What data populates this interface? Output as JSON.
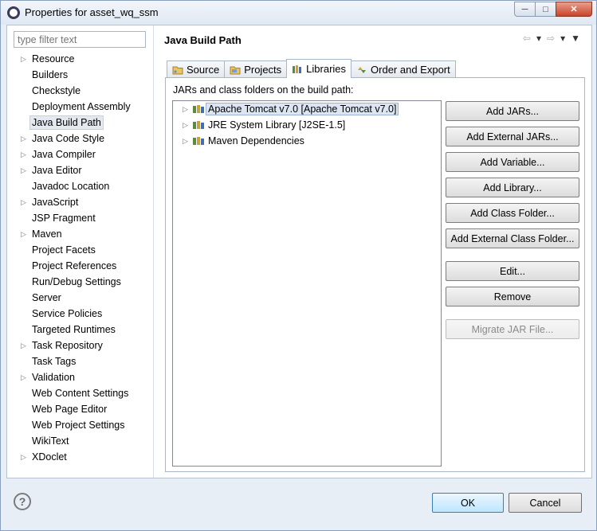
{
  "window": {
    "title": "Properties for asset_wq_ssm",
    "controls": [
      "minimize",
      "maximize",
      "close"
    ]
  },
  "filter": {
    "placeholder": "type filter text"
  },
  "nav_tree": [
    {
      "label": "Resource",
      "expandable": true
    },
    {
      "label": "Builders",
      "expandable": false
    },
    {
      "label": "Checkstyle",
      "expandable": false
    },
    {
      "label": "Deployment Assembly",
      "expandable": false
    },
    {
      "label": "Java Build Path",
      "expandable": false,
      "selected": true
    },
    {
      "label": "Java Code Style",
      "expandable": true
    },
    {
      "label": "Java Compiler",
      "expandable": true
    },
    {
      "label": "Java Editor",
      "expandable": true
    },
    {
      "label": "Javadoc Location",
      "expandable": false
    },
    {
      "label": "JavaScript",
      "expandable": true
    },
    {
      "label": "JSP Fragment",
      "expandable": false
    },
    {
      "label": "Maven",
      "expandable": true
    },
    {
      "label": "Project Facets",
      "expandable": false
    },
    {
      "label": "Project References",
      "expandable": false
    },
    {
      "label": "Run/Debug Settings",
      "expandable": false
    },
    {
      "label": "Server",
      "expandable": false
    },
    {
      "label": "Service Policies",
      "expandable": false
    },
    {
      "label": "Targeted Runtimes",
      "expandable": false
    },
    {
      "label": "Task Repository",
      "expandable": true
    },
    {
      "label": "Task Tags",
      "expandable": false
    },
    {
      "label": "Validation",
      "expandable": true
    },
    {
      "label": "Web Content Settings",
      "expandable": false
    },
    {
      "label": "Web Page Editor",
      "expandable": false
    },
    {
      "label": "Web Project Settings",
      "expandable": false
    },
    {
      "label": "WikiText",
      "expandable": false
    },
    {
      "label": "XDoclet",
      "expandable": true
    }
  ],
  "page": {
    "title": "Java Build Path",
    "tabs": [
      {
        "label": "Source",
        "icon": "source-folder-icon"
      },
      {
        "label": "Projects",
        "icon": "projects-icon"
      },
      {
        "label": "Libraries",
        "icon": "library-icon",
        "active": true
      },
      {
        "label": "Order and Export",
        "icon": "order-export-icon"
      }
    ],
    "description": "JARs and class folders on the build path:",
    "libraries": [
      {
        "label": "Apache Tomcat v7.0 [Apache Tomcat v7.0]",
        "selected": true
      },
      {
        "label": "JRE System Library [J2SE-1.5]"
      },
      {
        "label": "Maven Dependencies"
      }
    ],
    "buttons": {
      "add_jars": "Add JARs...",
      "add_external_jars": "Add External JARs...",
      "add_variable": "Add Variable...",
      "add_library": "Add Library...",
      "add_class_folder": "Add Class Folder...",
      "add_external_class_folder": "Add External Class Folder...",
      "edit": "Edit...",
      "remove": "Remove",
      "migrate_jar": "Migrate JAR File..."
    }
  },
  "footer": {
    "help": "?",
    "ok": "OK",
    "cancel": "Cancel"
  },
  "colors": {
    "accent": "#3c7fb1",
    "selection": "#dce6f3"
  }
}
